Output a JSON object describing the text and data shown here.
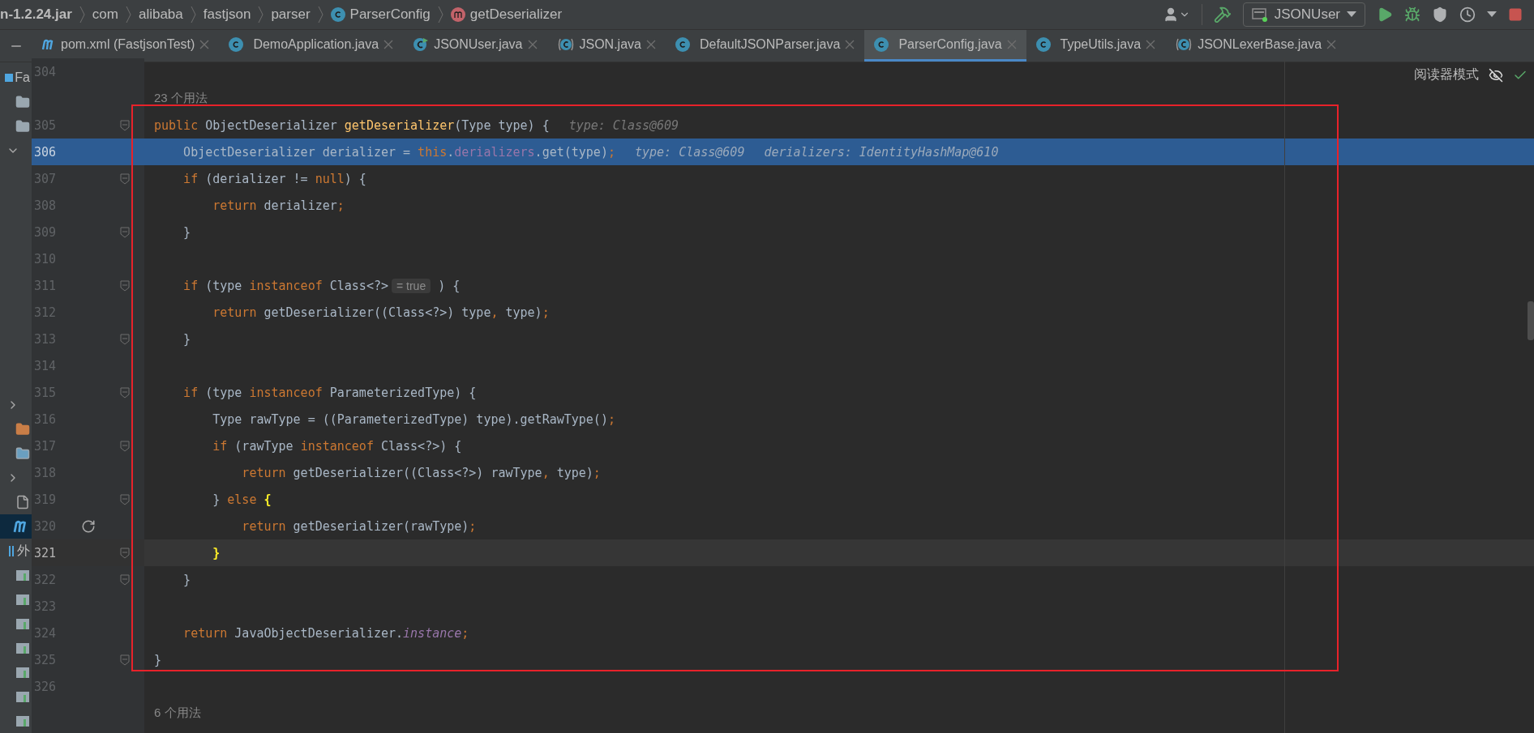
{
  "breadcrumbs": [
    {
      "text": "n-1.2.24.jar",
      "kind": "plain"
    },
    {
      "text": "com",
      "kind": "plain"
    },
    {
      "text": "alibaba",
      "kind": "plain"
    },
    {
      "text": "fastjson",
      "kind": "plain"
    },
    {
      "text": "parser",
      "kind": "plain"
    },
    {
      "text": "ParserConfig",
      "kind": "class"
    },
    {
      "text": "getDeserializer",
      "kind": "method"
    }
  ],
  "run_config": {
    "label": "JSONUser"
  },
  "tabs": [
    {
      "label": "pom.xml (FastjsonTest)",
      "kind": "maven",
      "selected": false
    },
    {
      "label": "DemoApplication.java",
      "kind": "class",
      "selected": false
    },
    {
      "label": "JSONUser.java",
      "kind": "runnable",
      "selected": false
    },
    {
      "label": "JSON.java",
      "kind": "library",
      "selected": false
    },
    {
      "label": "DefaultJSONParser.java",
      "kind": "class",
      "selected": false
    },
    {
      "label": "ParserConfig.java",
      "kind": "class",
      "selected": true
    },
    {
      "label": "TypeUtils.java",
      "kind": "class",
      "selected": false
    },
    {
      "label": "JSONLexerBase.java",
      "kind": "library",
      "selected": false
    }
  ],
  "project_panel": {
    "top": [
      {
        "kind": "project",
        "text": "Fa",
        "selected": false
      },
      {
        "kind": "folder",
        "selected": false
      },
      {
        "kind": "folder",
        "selected": false
      },
      {
        "kind": "chevron-down",
        "selected": false
      }
    ],
    "bottom": [
      {
        "kind": "chevron",
        "selected": false
      },
      {
        "kind": "folder-orange",
        "selected": false
      },
      {
        "kind": "web-folder",
        "selected": false
      },
      {
        "kind": "chevron",
        "selected": false
      },
      {
        "kind": "file",
        "selected": false
      },
      {
        "kind": "maven",
        "selected": true
      },
      {
        "kind": "libraries",
        "text": "外",
        "selected": false
      },
      {
        "kind": "library",
        "selected": false
      },
      {
        "kind": "library",
        "selected": false
      },
      {
        "kind": "library",
        "selected": false
      },
      {
        "kind": "library",
        "selected": false
      },
      {
        "kind": "library",
        "selected": false
      },
      {
        "kind": "library",
        "selected": false
      },
      {
        "kind": "library",
        "selected": false
      }
    ]
  },
  "reader_mode": {
    "label": "阅读器模式"
  },
  "editor": {
    "rows": [
      {
        "kind": "line",
        "number": "304",
        "tokens": []
      },
      {
        "kind": "usages",
        "text": "23 个用法"
      },
      {
        "kind": "line",
        "number": "305",
        "fold": true,
        "tokens": [
          {
            "kind": "kw",
            "text": "public"
          },
          {
            "kind": "plain",
            "text": " ObjectDeserializer "
          },
          {
            "kind": "decl",
            "text": "getDeserializer"
          },
          {
            "kind": "plain",
            "text": "(Type type) {"
          },
          {
            "kind": "hint",
            "text": "type: Class@609"
          }
        ]
      },
      {
        "kind": "line",
        "number": "306",
        "highlighted": true,
        "tokens": [
          {
            "kind": "plain",
            "text": "    ObjectDeserializer derializer = "
          },
          {
            "kind": "kw",
            "text": "this"
          },
          {
            "kind": "plain",
            "text": "."
          },
          {
            "kind": "field",
            "text": "derializers"
          },
          {
            "kind": "plain",
            "text": ".get(type)"
          },
          {
            "kind": "kw",
            "text": ";"
          },
          {
            "kind": "hint",
            "text": "type: Class@609"
          },
          {
            "kind": "hint",
            "text": "derializers: IdentityHashMap@610"
          }
        ]
      },
      {
        "kind": "line",
        "number": "307",
        "fold": true,
        "tokens": [
          {
            "kind": "kw",
            "text": "    if"
          },
          {
            "kind": "plain",
            "text": " (derializer != "
          },
          {
            "kind": "kw",
            "text": "null"
          },
          {
            "kind": "plain",
            "text": ") {"
          }
        ]
      },
      {
        "kind": "line",
        "number": "308",
        "tokens": [
          {
            "kind": "kw",
            "text": "        return"
          },
          {
            "kind": "plain",
            "text": " derializer"
          },
          {
            "kind": "kw",
            "text": ";"
          }
        ]
      },
      {
        "kind": "line",
        "number": "309",
        "fold": true,
        "tokens": [
          {
            "kind": "plain",
            "text": "    }"
          }
        ]
      },
      {
        "kind": "line",
        "number": "310",
        "tokens": []
      },
      {
        "kind": "line",
        "number": "311",
        "fold": true,
        "tokens": [
          {
            "kind": "kw",
            "text": "    if"
          },
          {
            "kind": "plain",
            "text": " (type "
          },
          {
            "kind": "kw",
            "text": "instanceof"
          },
          {
            "kind": "plain",
            "text": " Class<?>"
          },
          {
            "kind": "inlay",
            "text": "= true"
          },
          {
            "kind": "plain",
            "text": " ) {"
          }
        ]
      },
      {
        "kind": "line",
        "number": "312",
        "tokens": [
          {
            "kind": "kw",
            "text": "        return"
          },
          {
            "kind": "plain",
            "text": " getDeserializer((Class<?>) type"
          },
          {
            "kind": "kw",
            "text": ","
          },
          {
            "kind": "plain",
            "text": " type)"
          },
          {
            "kind": "kw",
            "text": ";"
          }
        ]
      },
      {
        "kind": "line",
        "number": "313",
        "fold": true,
        "tokens": [
          {
            "kind": "plain",
            "text": "    }"
          }
        ]
      },
      {
        "kind": "line",
        "number": "314",
        "tokens": []
      },
      {
        "kind": "line",
        "number": "315",
        "fold": true,
        "tokens": [
          {
            "kind": "kw",
            "text": "    if"
          },
          {
            "kind": "plain",
            "text": " (type "
          },
          {
            "kind": "kw",
            "text": "instanceof"
          },
          {
            "kind": "plain",
            "text": " ParameterizedType) {"
          }
        ]
      },
      {
        "kind": "line",
        "number": "316",
        "tokens": [
          {
            "kind": "plain",
            "text": "        Type rawType = ((ParameterizedType) type).getRawType()"
          },
          {
            "kind": "kw",
            "text": ";"
          }
        ]
      },
      {
        "kind": "line",
        "number": "317",
        "fold": true,
        "tokens": [
          {
            "kind": "kw",
            "text": "        if"
          },
          {
            "kind": "plain",
            "text": " (rawType "
          },
          {
            "kind": "kw",
            "text": "instanceof"
          },
          {
            "kind": "plain",
            "text": " Class<?>) {"
          }
        ]
      },
      {
        "kind": "line",
        "number": "318",
        "tokens": [
          {
            "kind": "kw",
            "text": "            return"
          },
          {
            "kind": "plain",
            "text": " getDeserializer((Class<?>) rawType"
          },
          {
            "kind": "kw",
            "text": ","
          },
          {
            "kind": "plain",
            "text": " type)"
          },
          {
            "kind": "kw",
            "text": ";"
          }
        ]
      },
      {
        "kind": "line",
        "number": "319",
        "fold": true,
        "tokens": [
          {
            "kind": "plain",
            "text": "        } "
          },
          {
            "kind": "kw",
            "text": "else"
          },
          {
            "kind": "match",
            "text": " {"
          }
        ]
      },
      {
        "kind": "line",
        "number": "320",
        "marker": true,
        "tokens": [
          {
            "kind": "kw",
            "text": "            return"
          },
          {
            "kind": "plain",
            "text": " getDeserializer(rawType)"
          },
          {
            "kind": "kw",
            "text": ";"
          }
        ]
      },
      {
        "kind": "line",
        "number": "321",
        "current": true,
        "fold": true,
        "tokens": [
          {
            "kind": "match",
            "text": "        }"
          }
        ]
      },
      {
        "kind": "line",
        "number": "322",
        "fold": true,
        "tokens": [
          {
            "kind": "plain",
            "text": "    }"
          }
        ]
      },
      {
        "kind": "line",
        "number": "323",
        "tokens": []
      },
      {
        "kind": "line",
        "number": "324",
        "tokens": [
          {
            "kind": "kw",
            "text": "    return"
          },
          {
            "kind": "plain",
            "text": " JavaObjectDeserializer."
          },
          {
            "kind": "static",
            "text": "instance"
          },
          {
            "kind": "kw",
            "text": ";"
          }
        ]
      },
      {
        "kind": "line",
        "number": "325",
        "fold": true,
        "tokens": [
          {
            "kind": "plain",
            "text": "}"
          }
        ]
      },
      {
        "kind": "line",
        "number": "326",
        "tokens": []
      },
      {
        "kind": "usages",
        "text": "6 个用法"
      }
    ]
  }
}
